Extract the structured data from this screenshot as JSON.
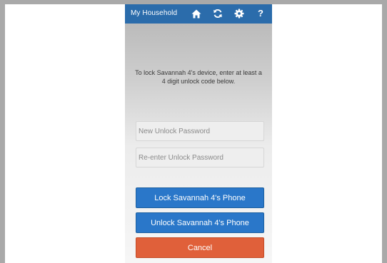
{
  "header": {
    "title": "My Household",
    "icons": [
      "home-icon",
      "refresh-icon",
      "gear-icon",
      "help-icon"
    ],
    "help_glyph": "?"
  },
  "instructions": "To lock Savannah 4's device, enter at least a 4 digit unlock code below.",
  "form": {
    "new_password_placeholder": "New Unlock Password",
    "reenter_password_placeholder": "Re-enter Unlock Password",
    "new_password_value": "",
    "reenter_password_value": ""
  },
  "buttons": {
    "lock_label": "Lock Savannah 4's Phone",
    "unlock_label": "Unlock Savannah 4's Phone",
    "cancel_label": "Cancel"
  },
  "colors": {
    "header_bg": "#2b6cab",
    "primary_button": "#2a77c9",
    "cancel_button": "#e0603a"
  }
}
